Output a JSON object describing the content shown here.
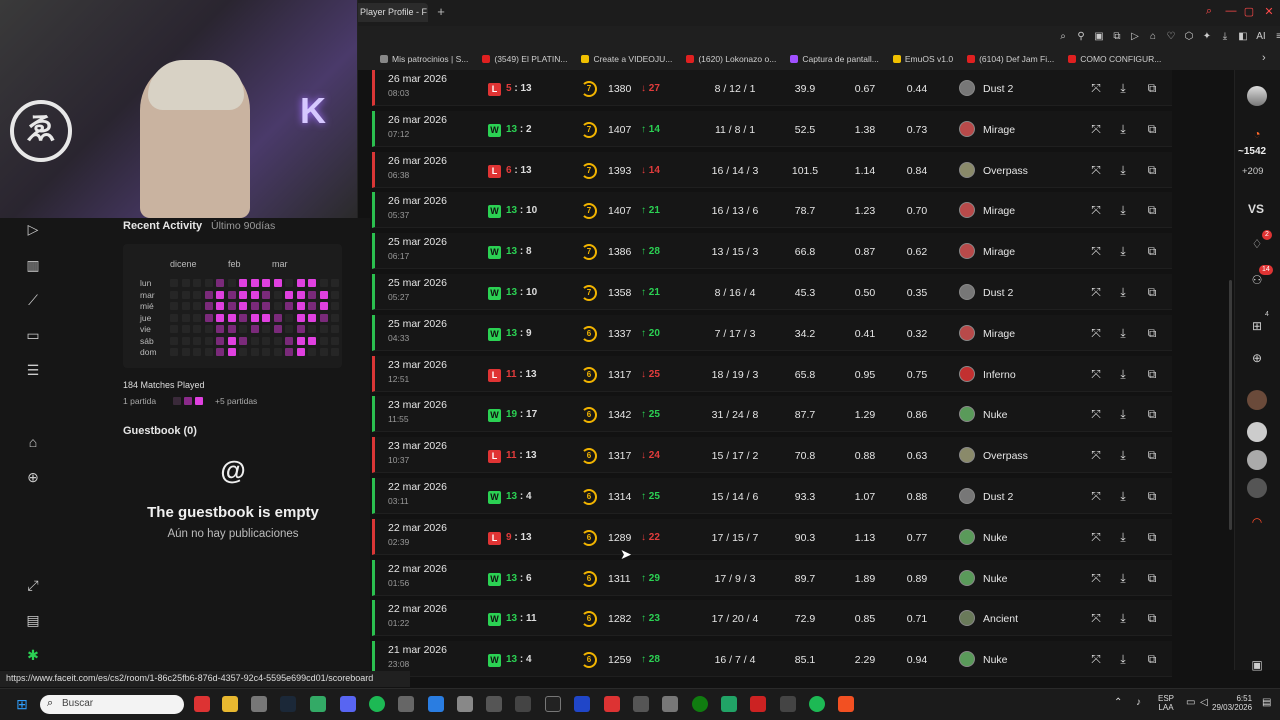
{
  "browser": {
    "active_tab": "Player Profile - F",
    "new_tab": "+",
    "bookmarks": [
      {
        "label": "Mis patrocinios | S...",
        "color": "#888888"
      },
      {
        "label": "(3549) El PLATIN...",
        "color": "#e02020"
      },
      {
        "label": "Create a VIDEOJU...",
        "color": "#f0c000"
      },
      {
        "label": "(1620) Lokonazo o...",
        "color": "#e02020"
      },
      {
        "label": "Captura de pantall...",
        "color": "#a050ff"
      },
      {
        "label": "EmuOS v1.0",
        "color": "#f0c000"
      },
      {
        "label": "(6104) Def Jam Fi...",
        "color": "#e02020"
      },
      {
        "label": "COMO CONFIGUR...",
        "color": "#e02020"
      }
    ],
    "toolbar_ai": "AI",
    "status_url": "https://www.faceit.com/es/cs2/room/1-86c25fb6-876d-4357-92c4-5595e699cd01/scoreboard"
  },
  "sidebar": {
    "recent_activity_title": "Recent Activity",
    "recent_activity_range": "Último 90días",
    "heatmap_months": [
      "dicene",
      "feb",
      "mar"
    ],
    "heatmap_days": [
      "lun",
      "mar",
      "mié",
      "jue",
      "vie",
      "sáb",
      "dom"
    ],
    "matches_played": "184 Matches Played",
    "legend_low": "1 partida",
    "legend_high": "+5 partidas",
    "guestbook_title": "Guestbook (0)",
    "guestbook_icon": "@",
    "guestbook_empty": "The guestbook is empty",
    "guestbook_none": "Aún no hay publicaciones"
  },
  "matches": [
    {
      "date": "26 mar 2026",
      "time": "08:03",
      "result": "L",
      "score_a": "5",
      "score_b": "13",
      "level": "7",
      "elo": "1380",
      "delta": "27",
      "dir": "down",
      "kda": "8 / 12 / 1",
      "adr": "39.9",
      "kd": "0.67",
      "kr": "0.44",
      "map": "Dust 2"
    },
    {
      "date": "26 mar 2026",
      "time": "07:12",
      "result": "W",
      "score_a": "13",
      "score_b": "2",
      "level": "7",
      "elo": "1407",
      "delta": "14",
      "dir": "up",
      "kda": "11 / 8 / 1",
      "adr": "52.5",
      "kd": "1.38",
      "kr": "0.73",
      "map": "Mirage"
    },
    {
      "date": "26 mar 2026",
      "time": "06:38",
      "result": "L",
      "score_a": "6",
      "score_b": "13",
      "level": "7",
      "elo": "1393",
      "delta": "14",
      "dir": "down",
      "kda": "16 / 14 / 3",
      "adr": "101.5",
      "kd": "1.14",
      "kr": "0.84",
      "map": "Overpass"
    },
    {
      "date": "26 mar 2026",
      "time": "05:37",
      "result": "W",
      "score_a": "13",
      "score_b": "10",
      "level": "7",
      "elo": "1407",
      "delta": "21",
      "dir": "up",
      "kda": "16 / 13 / 6",
      "adr": "78.7",
      "kd": "1.23",
      "kr": "0.70",
      "map": "Mirage"
    },
    {
      "date": "25 mar 2026",
      "time": "06:17",
      "result": "W",
      "score_a": "13",
      "score_b": "8",
      "level": "7",
      "elo": "1386",
      "delta": "28",
      "dir": "up",
      "kda": "13 / 15 / 3",
      "adr": "66.8",
      "kd": "0.87",
      "kr": "0.62",
      "map": "Mirage"
    },
    {
      "date": "25 mar 2026",
      "time": "05:27",
      "result": "W",
      "score_a": "13",
      "score_b": "10",
      "level": "7",
      "elo": "1358",
      "delta": "21",
      "dir": "up",
      "kda": "8 / 16 / 4",
      "adr": "45.3",
      "kd": "0.50",
      "kr": "0.35",
      "map": "Dust 2"
    },
    {
      "date": "25 mar 2026",
      "time": "04:33",
      "result": "W",
      "score_a": "13",
      "score_b": "9",
      "level": "6",
      "elo": "1337",
      "delta": "20",
      "dir": "up",
      "kda": "7 / 17 / 3",
      "adr": "34.2",
      "kd": "0.41",
      "kr": "0.32",
      "map": "Mirage"
    },
    {
      "date": "23 mar 2026",
      "time": "12:51",
      "result": "L",
      "score_a": "11",
      "score_b": "13",
      "level": "6",
      "elo": "1317",
      "delta": "25",
      "dir": "down",
      "kda": "18 / 19 / 3",
      "adr": "65.8",
      "kd": "0.95",
      "kr": "0.75",
      "map": "Inferno"
    },
    {
      "date": "23 mar 2026",
      "time": "11:55",
      "result": "W",
      "score_a": "19",
      "score_b": "17",
      "level": "6",
      "elo": "1342",
      "delta": "25",
      "dir": "up",
      "kda": "31 / 24 / 8",
      "adr": "87.7",
      "kd": "1.29",
      "kr": "0.86",
      "map": "Nuke"
    },
    {
      "date": "23 mar 2026",
      "time": "10:37",
      "result": "L",
      "score_a": "11",
      "score_b": "13",
      "level": "6",
      "elo": "1317",
      "delta": "24",
      "dir": "down",
      "kda": "15 / 17 / 2",
      "adr": "70.8",
      "kd": "0.88",
      "kr": "0.63",
      "map": "Overpass"
    },
    {
      "date": "22 mar 2026",
      "time": "03:11",
      "result": "W",
      "score_a": "13",
      "score_b": "4",
      "level": "6",
      "elo": "1314",
      "delta": "25",
      "dir": "up",
      "kda": "15 / 14 / 6",
      "adr": "93.3",
      "kd": "1.07",
      "kr": "0.88",
      "map": "Dust 2"
    },
    {
      "date": "22 mar 2026",
      "time": "02:39",
      "result": "L",
      "score_a": "9",
      "score_b": "13",
      "level": "6",
      "elo": "1289",
      "delta": "22",
      "dir": "down",
      "kda": "17 / 15 / 7",
      "adr": "90.3",
      "kd": "1.13",
      "kr": "0.77",
      "map": "Nuke"
    },
    {
      "date": "22 mar 2026",
      "time": "01:56",
      "result": "W",
      "score_a": "13",
      "score_b": "6",
      "level": "6",
      "elo": "1311",
      "delta": "29",
      "dir": "up",
      "kda": "17 / 9 / 3",
      "adr": "89.7",
      "kd": "1.89",
      "kr": "0.89",
      "map": "Nuke"
    },
    {
      "date": "22 mar 2026",
      "time": "01:22",
      "result": "W",
      "score_a": "13",
      "score_b": "11",
      "level": "6",
      "elo": "1282",
      "delta": "23",
      "dir": "up",
      "kda": "17 / 20 / 4",
      "adr": "72.9",
      "kd": "0.85",
      "kr": "0.71",
      "map": "Ancient"
    },
    {
      "date": "21 mar 2026",
      "time": "23:08",
      "result": "W",
      "score_a": "13",
      "score_b": "4",
      "level": "6",
      "elo": "1259",
      "delta": "28",
      "dir": "up",
      "kda": "16 / 7 / 4",
      "adr": "85.1",
      "kd": "2.29",
      "kr": "0.94",
      "map": "Nuke"
    }
  ],
  "rightbar": {
    "elo": "~1542",
    "elo_plus": "+209",
    "vs": "VS",
    "notif_count": "2",
    "friends_count": "14",
    "party_count": "4"
  },
  "taskbar": {
    "search_placeholder": "Buscar",
    "lang_top": "ESP",
    "lang_bottom": "LAA",
    "time": "6:51",
    "date": "29/03/2026"
  },
  "colors": {
    "win": "#2bd153",
    "loss": "#e23c3c",
    "level": "#f2b400",
    "heat": "#e040e0"
  }
}
